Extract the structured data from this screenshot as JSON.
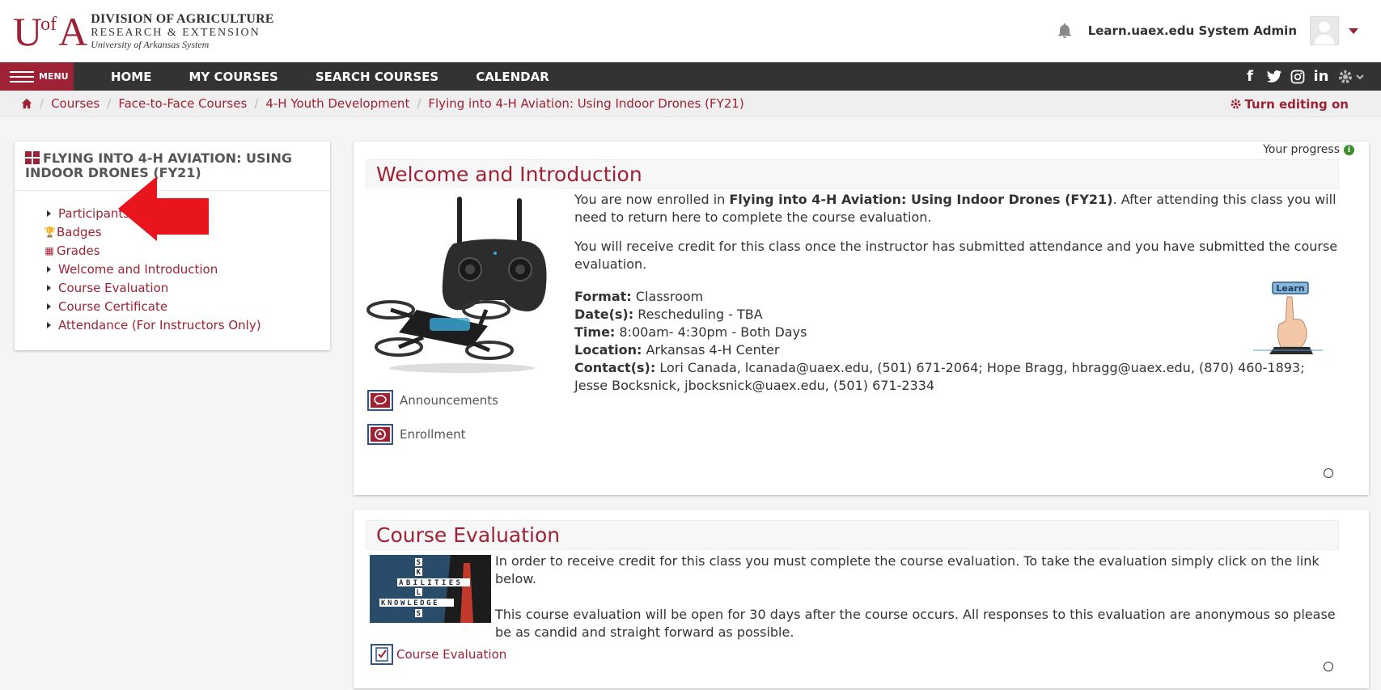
{
  "header": {
    "logo_mark": "UofA",
    "logo_line1": "DIVISION OF AGRICULTURE",
    "logo_line2": "RESEARCH & EXTENSION",
    "logo_line3": "University of Arkansas System",
    "user_name": "Learn.uaex.edu System Admin"
  },
  "nav": {
    "menu_label": "MENU",
    "items": [
      "HOME",
      "MY COURSES",
      "SEARCH COURSES",
      "CALENDAR"
    ]
  },
  "breadcrumb": {
    "items": [
      "Courses",
      "Face-to-Face Courses",
      "4-H Youth Development",
      "Flying into 4-H Aviation: Using Indoor Drones (FY21)"
    ],
    "edit_label": "Turn editing on"
  },
  "sidebar": {
    "title": "FLYING INTO 4-H AVIATION: USING INDOOR DRONES (FY21)",
    "items": [
      {
        "label": "Participants",
        "icon": "triangle-icon"
      },
      {
        "label": "Badges",
        "icon": "trophy-icon"
      },
      {
        "label": "Grades",
        "icon": "table-icon"
      },
      {
        "label": "Welcome and Introduction",
        "icon": "triangle-icon"
      },
      {
        "label": "Course Evaluation",
        "icon": "triangle-icon"
      },
      {
        "label": "Course Certificate",
        "icon": "triangle-icon"
      },
      {
        "label": "Attendance (For Instructors Only)",
        "icon": "triangle-icon"
      }
    ]
  },
  "main": {
    "progress_label": "Your progress",
    "section1": {
      "title": "Welcome and Introduction",
      "p1_pre": "You are now enrolled in ",
      "p1_bold": "Flying into 4-H Aviation: Using Indoor Drones (FY21)",
      "p1_post": ".  After attending this class you will need to return here to complete the course evaluation.",
      "p2": "You will receive credit for this class once the instructor has submitted attendance and you have submitted the course evaluation.",
      "format_label": "Format:",
      "format_value": " Classroom",
      "dates_label": "Date(s):",
      "dates_value": " Rescheduling - TBA",
      "time_label": "Time:",
      "time_value": " 8:00am- 4:30pm - Both Days",
      "location_label": "Location:",
      "location_value": " Arkansas 4-H Center",
      "contacts_label": "Contact(s):",
      "contacts_value": " Lori Canada, lcanada@uaex.edu, (501) 671-2064; Hope Bragg, hbragg@uaex.edu, (870) 460-1893; Jesse Bocksnick, jbocksnick@uaex.edu, (501) 671-2334",
      "learn_badge": "Learn",
      "activities": [
        "Announcements",
        "Enrollment"
      ]
    },
    "section2": {
      "title": "Course Evaluation",
      "p1": "In order to receive credit for this class you must complete the course evaluation.  To take the evaluation simply click on the link below.",
      "p2": "This course evaluation will be open for 30 days after the course occurs.  All responses to this evaluation are anonymous so please be as candid and straight forward as possible.",
      "activity": "Course Evaluation"
    }
  },
  "colors": {
    "brand": "#9d2235",
    "navbar": "#333333",
    "arrow": "#e8151d"
  }
}
